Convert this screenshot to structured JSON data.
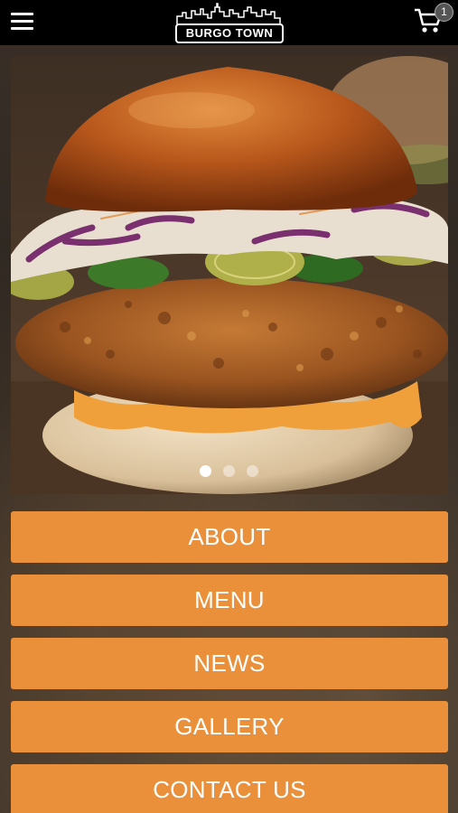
{
  "header": {
    "brand": "BURGO TOWN",
    "cart_count": "1",
    "icons": [
      "hamburger-menu-icon",
      "cart-icon"
    ]
  },
  "hero": {
    "slide_count": 3,
    "active_slide": 1
  },
  "nav": {
    "items": [
      {
        "label": "ABOUT"
      },
      {
        "label": "MENU"
      },
      {
        "label": "NEWS"
      },
      {
        "label": "GALLERY"
      },
      {
        "label": "CONTACT US"
      }
    ]
  },
  "colors": {
    "header_bg": "#000000",
    "button_bg": "#ea903b",
    "button_text": "#ffffff"
  }
}
